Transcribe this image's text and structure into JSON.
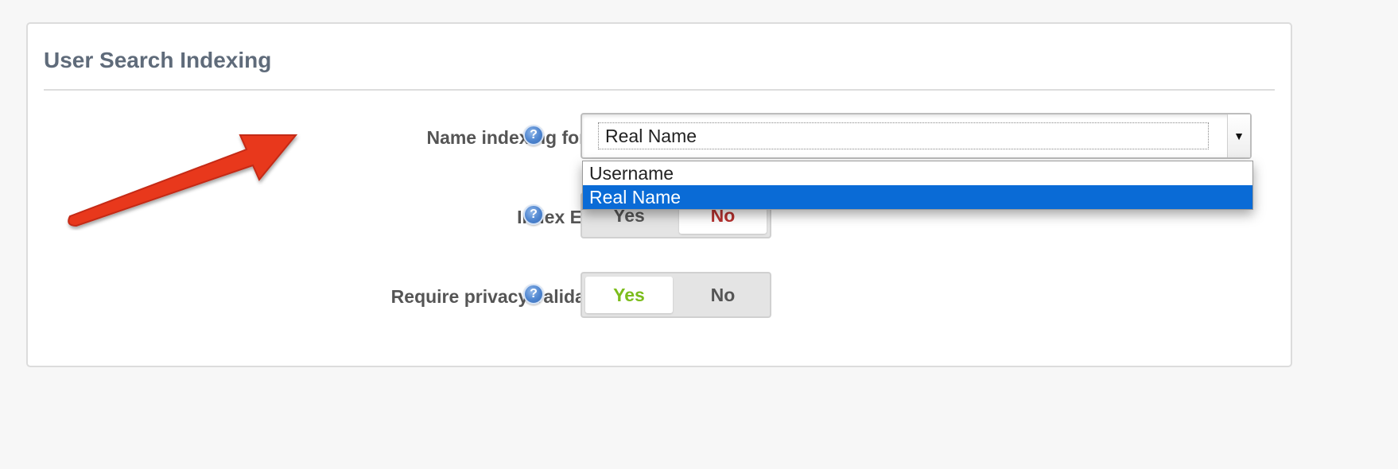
{
  "panel": {
    "title": "User Search Indexing"
  },
  "fields": {
    "name_indexing": {
      "label": "Name indexing format",
      "help": "?",
      "value": "Real Name",
      "options": [
        "Username",
        "Real Name"
      ],
      "selected_index": 1
    },
    "index_email": {
      "label": "Index Email",
      "help": "?",
      "yes": "Yes",
      "no": "No",
      "selected": "No"
    },
    "privacy_validation": {
      "label": "Require privacy validation",
      "help": "?",
      "yes": "Yes",
      "no": "No",
      "selected": "Yes"
    }
  },
  "colors": {
    "title": "#5f6b7a",
    "yes_active": "#7cbd1c",
    "no_active": "#b8312f",
    "highlight": "#0a6bd6",
    "annotation_arrow": "#e8381f"
  },
  "icons": {
    "help": "help-circle-icon",
    "dropdown": "caret-down-icon",
    "annotation": "red-arrow-annotation"
  }
}
